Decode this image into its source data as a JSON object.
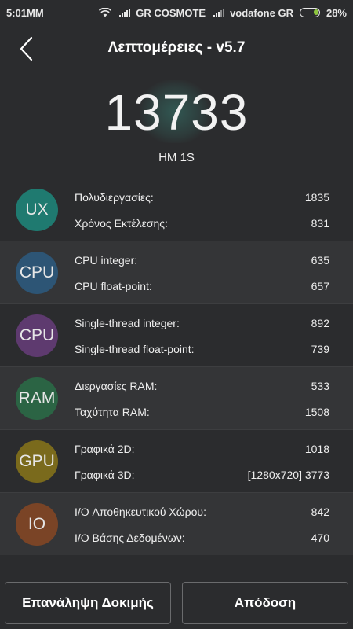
{
  "status": {
    "time": "5:01MM",
    "carrier1": "GR COSMOTE",
    "carrier2": "vodafone GR",
    "battery": "28%",
    "battery_level": 0.28
  },
  "header": {
    "title": "Λεπτομέρειες - v5.7"
  },
  "score": {
    "value": "13733",
    "device": "HM 1S"
  },
  "categories": [
    {
      "icon": "UX",
      "color": "#1f7a70",
      "metrics": [
        {
          "label": "Πολυδιεργασίες:",
          "value": "1835"
        },
        {
          "label": "Χρόνος Εκτέλεσης:",
          "value": "831"
        }
      ]
    },
    {
      "icon": "CPU",
      "color": "#2d5575",
      "metrics": [
        {
          "label": "CPU integer:",
          "value": "635"
        },
        {
          "label": "CPU float-point:",
          "value": "657"
        }
      ]
    },
    {
      "icon": "CPU",
      "color": "#5e3a6f",
      "metrics": [
        {
          "label": "Single-thread integer:",
          "value": "892"
        },
        {
          "label": "Single-thread float-point:",
          "value": "739"
        }
      ]
    },
    {
      "icon": "RAM",
      "color": "#2b6444",
      "metrics": [
        {
          "label": "Διεργασίες RAM:",
          "value": "533"
        },
        {
          "label": "Ταχύτητα RAM:",
          "value": "1508"
        }
      ]
    },
    {
      "icon": "GPU",
      "color": "#7a6a1c",
      "metrics": [
        {
          "label": "Γραφικά 2D:",
          "value": "1018"
        },
        {
          "label": "Γραφικά 3D:",
          "value": "[1280x720] 3773"
        }
      ]
    },
    {
      "icon": "IO",
      "color": "#7a4426",
      "metrics": [
        {
          "label": "I/O Αποθηκευτικού Χώρου:",
          "value": "842"
        },
        {
          "label": "I/O Βάσης Δεδομένων:",
          "value": "470"
        }
      ]
    }
  ],
  "buttons": {
    "retest": "Επανάληψη Δοκιμής",
    "performance": "Απόδοση"
  }
}
